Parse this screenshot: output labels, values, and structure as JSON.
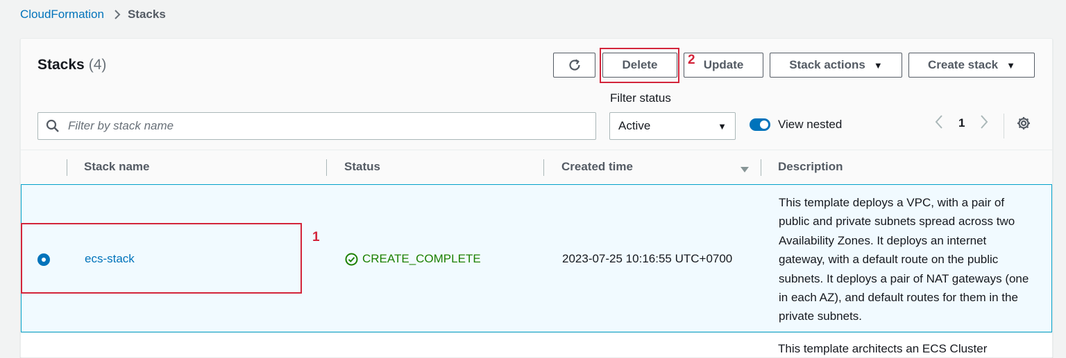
{
  "breadcrumb": {
    "root": "CloudFormation",
    "current": "Stacks"
  },
  "header": {
    "title": "Stacks",
    "count": "(4)"
  },
  "toolbar": {
    "delete_label": "Delete",
    "update_label": "Update",
    "stack_actions_label": "Stack actions",
    "create_stack_label": "Create stack"
  },
  "filters": {
    "search_placeholder": "Filter by stack name",
    "search_value": "",
    "status_label": "Filter status",
    "status_value": "Active",
    "view_nested_label": "View nested",
    "view_nested_on": true
  },
  "pagination": {
    "current_page": "1"
  },
  "table": {
    "columns": [
      "Stack name",
      "Status",
      "Created time",
      "Description"
    ],
    "rows": [
      {
        "selected": true,
        "stack_name": "ecs-stack",
        "status": "CREATE_COMPLETE",
        "created_time": "2023-07-25 10:16:55 UTC+0700",
        "description": "This template deploys a VPC, with a pair of public and private subnets spread across two Availability Zones. It deploys an internet gateway, with a default route on the public subnets. It deploys a pair of NAT gateways (one in each AZ), and default routes for them in the private subnets."
      },
      {
        "selected": false,
        "description_partial": "This template architects an ECS Cluster"
      }
    ]
  },
  "annotations": {
    "label_1": "1",
    "label_2": "2"
  },
  "colors": {
    "link": "#0073bb",
    "success": "#1d8102",
    "annotation": "#d3243a",
    "selected_row_bg": "#f1faff",
    "selected_row_border": "#00a1c9"
  }
}
